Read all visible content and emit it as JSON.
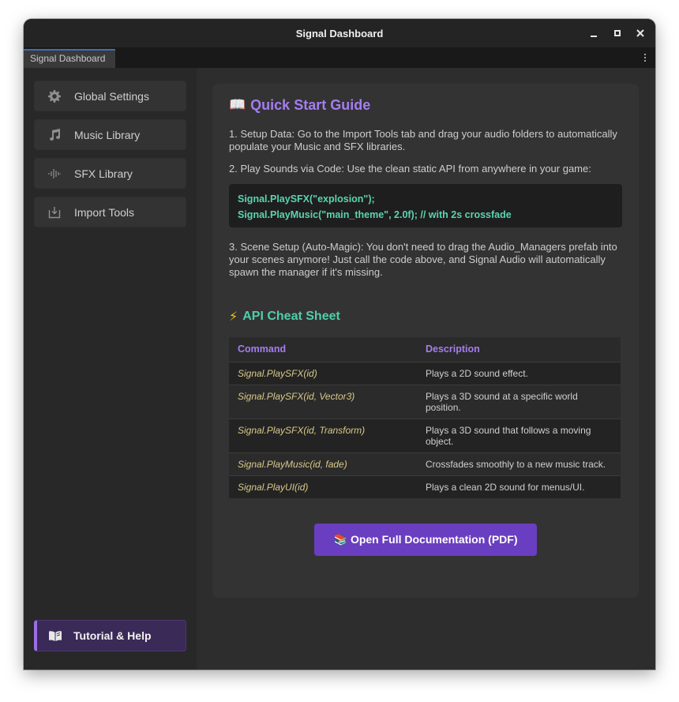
{
  "window": {
    "title": "Signal Dashboard",
    "tab_label": "Signal Dashboard"
  },
  "sidebar": {
    "items": [
      {
        "label": "Global Settings",
        "icon": "gear-icon"
      },
      {
        "label": "Music Library",
        "icon": "music-note-icon"
      },
      {
        "label": "SFX Library",
        "icon": "waveform-icon"
      },
      {
        "label": "Import Tools",
        "icon": "import-icon"
      }
    ],
    "active_item": {
      "label": "Tutorial & Help",
      "icon": "open-book-icon"
    }
  },
  "guide": {
    "title_emoji": "📖",
    "title": "Quick Start Guide",
    "step1": "1. Setup Data: Go to the Import Tools tab and drag your audio folders to automatically populate your Music and SFX libraries.",
    "step2": "2. Play Sounds via Code: Use the clean static API from anywhere in your game:",
    "code_line1": "Signal.PlaySFX(\"explosion\");",
    "code_line2": "Signal.PlayMusic(\"main_theme\", 2.0f); // with 2s crossfade",
    "step3": "3. Scene Setup (Auto-Magic): You don't need to drag the Audio_Managers prefab into your scenes anymore! Just call the code above, and Signal Audio will automatically spawn the manager if it's missing."
  },
  "cheatsheet": {
    "title_emoji": "⚡",
    "title": "API Cheat Sheet",
    "headers": [
      "Command",
      "Description"
    ],
    "rows": [
      [
        "Signal.PlaySFX(id)",
        "Plays a 2D sound effect."
      ],
      [
        "Signal.PlaySFX(id, Vector3)",
        "Plays a 3D sound at a specific world position."
      ],
      [
        "Signal.PlaySFX(id, Transform)",
        "Plays a 3D sound that follows a moving object."
      ],
      [
        "Signal.PlayMusic(id, fade)",
        "Crossfades smoothly to a new music track."
      ],
      [
        "Signal.PlayUI(id)",
        "Plays a clean 2D sound for menus/UI."
      ]
    ]
  },
  "docs_button": {
    "emoji": "📚",
    "label": "Open Full Documentation (PDF)"
  },
  "colors": {
    "accent_purple": "#a57df0",
    "accent_green": "#4fcfa8",
    "button_purple": "#6a3ec0",
    "code_green": "#5bd4b0"
  }
}
